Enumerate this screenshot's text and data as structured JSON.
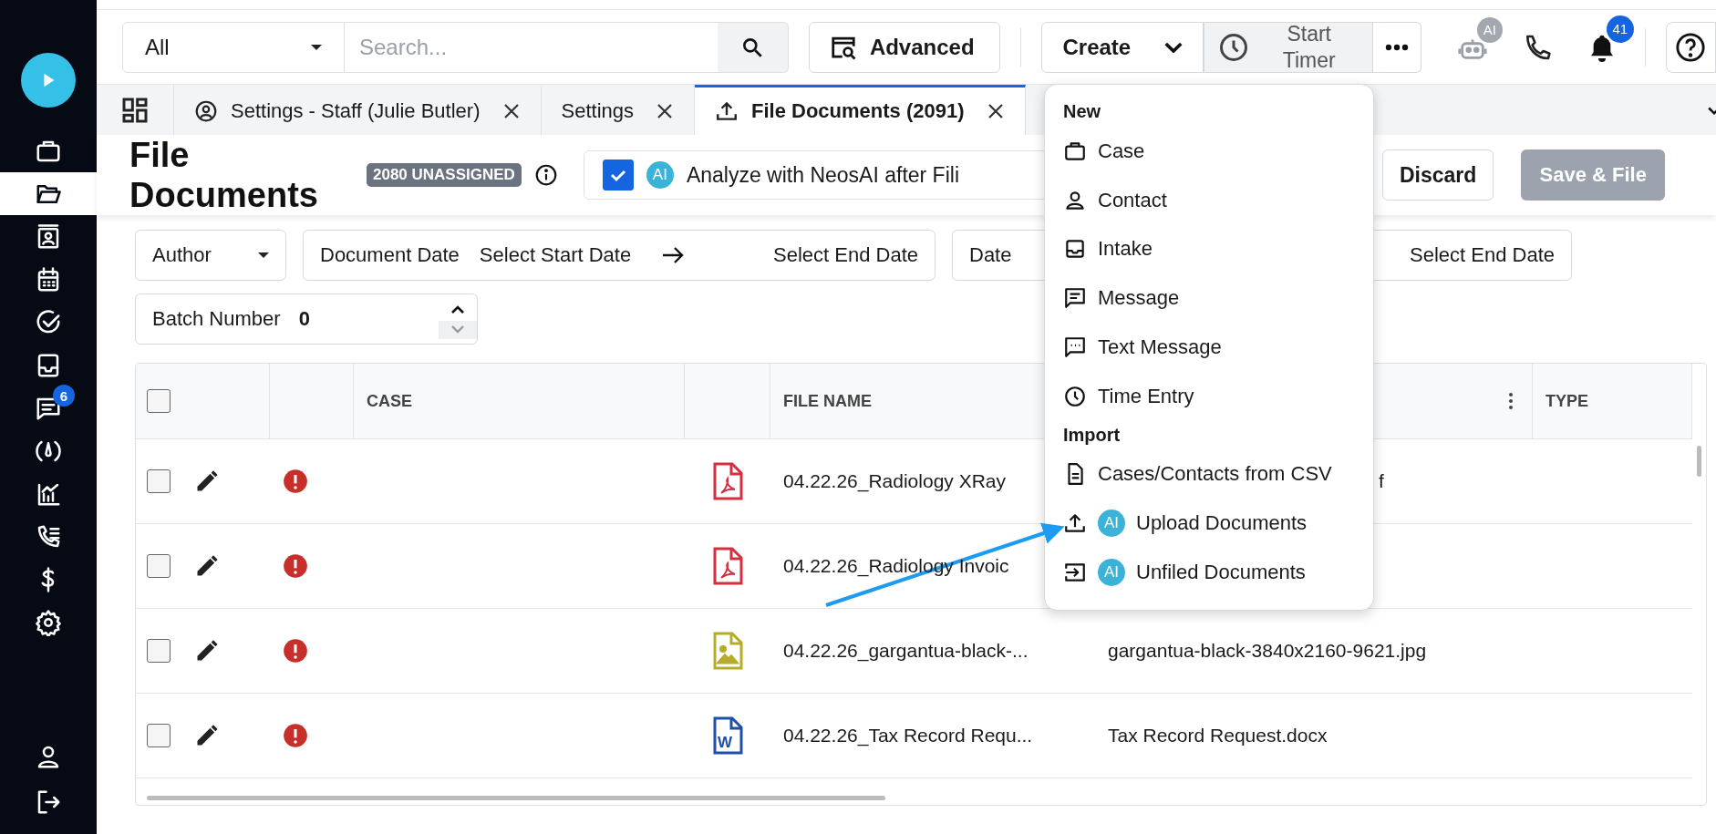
{
  "sidebar": {
    "items": [
      {
        "selected": false
      },
      {
        "selected": true
      },
      {
        "selected": false
      },
      {
        "selected": false
      },
      {
        "selected": false
      },
      {
        "selected": false
      },
      {
        "selected": false,
        "badge": "6"
      },
      {
        "selected": false
      },
      {
        "selected": false
      },
      {
        "selected": false
      },
      {
        "selected": false
      },
      {
        "selected": false
      }
    ],
    "bottom_items": [
      {
        "selected": false
      },
      {
        "selected": false
      }
    ]
  },
  "toolbar": {
    "scope": "All",
    "search": {
      "placeholder": "Search..."
    },
    "advanced": "Advanced",
    "create": "Create",
    "start_timer": "Start Timer",
    "ai_badge": "AI",
    "notifications": "41"
  },
  "tabs": [
    {
      "label": "Settings - Staff (Julie Butler)",
      "selected": false
    },
    {
      "label": "Settings",
      "selected": false
    },
    {
      "label": "File Documents (2091)",
      "selected": true
    }
  ],
  "page": {
    "title": "File Documents",
    "unassigned": "2080 UNASSIGNED",
    "analyze": {
      "checked": true,
      "badge": "AI",
      "label": "Analyze with NeosAI after Fili"
    },
    "discard": "Discard",
    "save": {
      "label": "Save & File",
      "disabled": true
    }
  },
  "filters": {
    "author": "Author",
    "document_date": {
      "label": "Document Date",
      "start": "Select Start Date",
      "end": "Select End Date"
    },
    "date_2": {
      "label": "Date",
      "end": "Select End Date"
    },
    "batch": {
      "label": "Batch Number",
      "value": "0"
    }
  },
  "table": {
    "all_checked": false,
    "columns": [
      "CASE",
      "FILE NAME",
      "TYPE"
    ],
    "rows": [
      {
        "checked": false,
        "flagged": true,
        "kind": "pdf",
        "file_name": "04.22.26_Radiology XRay",
        "original_name": "f"
      },
      {
        "checked": false,
        "flagged": true,
        "kind": "pdf",
        "file_name": "04.22.26_Radiology Invoic"
      },
      {
        "checked": false,
        "flagged": true,
        "kind": "image",
        "file_name": "04.22.26_gargantua-black-...",
        "original_name": "gargantua-black-3840x2160-9621.jpg"
      },
      {
        "checked": false,
        "flagged": true,
        "kind": "word",
        "file_name": "04.22.26_Tax Record Requ...",
        "original_name": "Tax Record Request.docx",
        "doc_letter": "W"
      }
    ]
  },
  "create_menu": {
    "sections": [
      {
        "heading": "New",
        "items": [
          {
            "label": "Case"
          },
          {
            "label": "Contact"
          },
          {
            "label": "Intake"
          },
          {
            "label": "Message"
          },
          {
            "label": "Text Message"
          },
          {
            "label": "Time Entry"
          }
        ]
      },
      {
        "heading": "Import",
        "items": [
          {
            "label": "Cases/Contacts from CSV"
          },
          {
            "label": "Upload Documents",
            "badge": "AI"
          },
          {
            "label": "Unfiled Documents",
            "badge": "AI"
          }
        ]
      }
    ]
  }
}
